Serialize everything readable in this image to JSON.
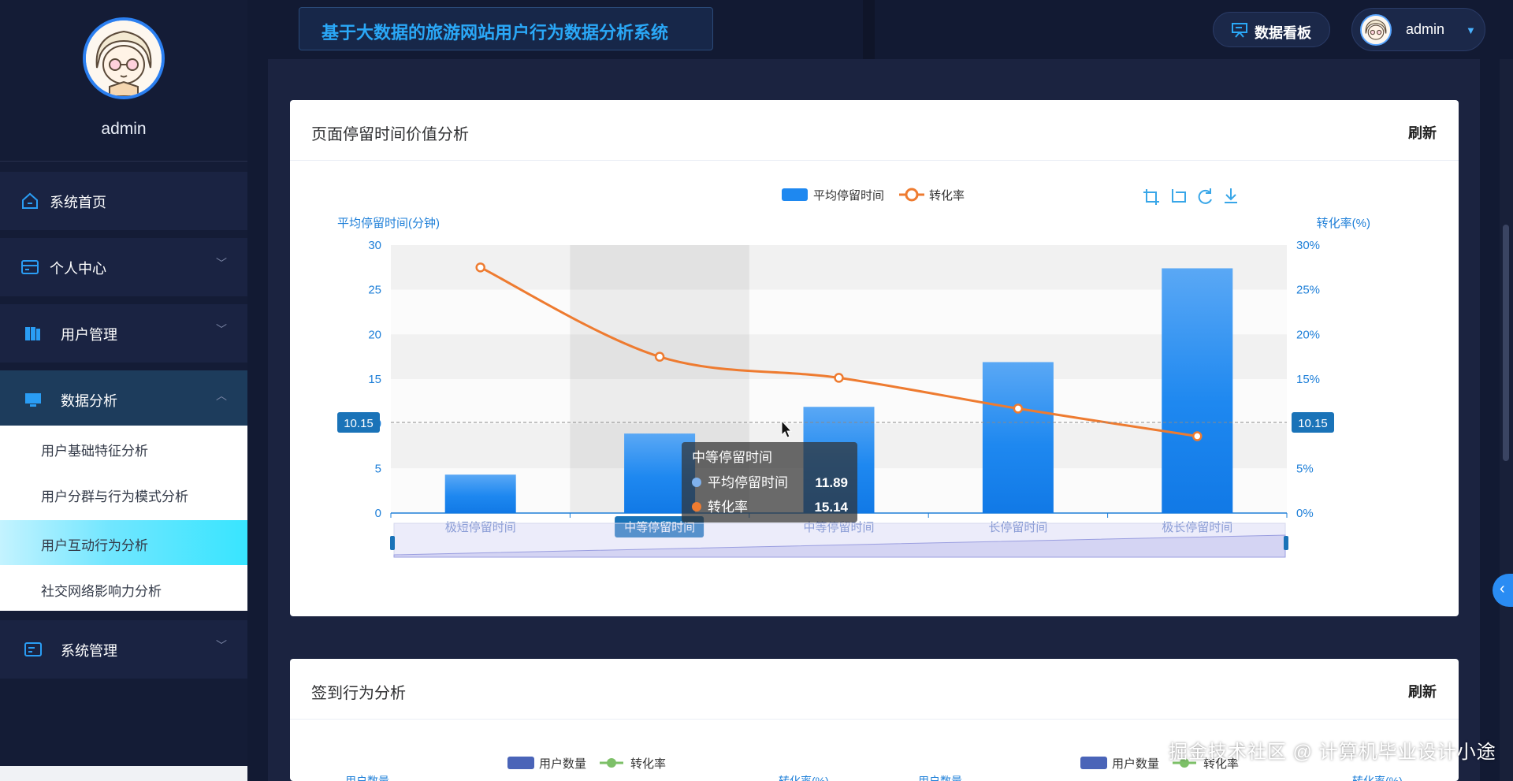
{
  "app": {
    "title": "基于大数据的旅游网站用户行为数据分析系统"
  },
  "header": {
    "dashboard_label": "数据看板",
    "user_name": "admin"
  },
  "sidebar": {
    "user_name": "admin",
    "menu": [
      {
        "label": "系统首页",
        "icon": "home-icon"
      },
      {
        "label": "个人中心",
        "icon": "card-icon"
      },
      {
        "label": "用户管理",
        "icon": "book-icon"
      },
      {
        "label": "数据分析",
        "icon": "monitor-icon"
      },
      {
        "label": "系统管理",
        "icon": "id-card-icon"
      }
    ],
    "submenu": [
      {
        "label": "用户基础特征分析"
      },
      {
        "label": "用户分群与行为模式分析"
      },
      {
        "label": "用户互动行为分析",
        "active": true
      },
      {
        "label": "社交网络影响力分析"
      }
    ]
  },
  "card1": {
    "title": "页面停留时间价值分析",
    "refresh": "刷新"
  },
  "card2": {
    "title": "签到行为分析",
    "refresh": "刷新",
    "legend_left": [
      "用户数量",
      "转化率"
    ],
    "legend_right": [
      "用户数量",
      "转化率"
    ],
    "partial_labels": [
      "用户数量",
      "转化率(%)",
      "用户数量",
      "转化率(%)"
    ]
  },
  "chart_data": {
    "type": "bar",
    "categories": [
      "极短停留时间",
      "中等停留时间",
      "中等停留时间",
      "长停留时间",
      "极长停留时间"
    ],
    "series": [
      {
        "name": "平均停留时间",
        "type": "bar",
        "axis": "left",
        "color": "#1e88f0",
        "values": [
          4.3,
          8.9,
          11.89,
          16.9,
          27.4
        ]
      },
      {
        "name": "转化率",
        "type": "line",
        "axis": "right",
        "color": "#ee7b30",
        "values": [
          27.5,
          17.5,
          15.14,
          11.7,
          8.6
        ]
      }
    ],
    "ylabel": "平均停留时间(分钟)",
    "y2label": "转化率(%)",
    "ylim": [
      0,
      30
    ],
    "y2lim": [
      0,
      30
    ],
    "yticks": [
      "0",
      "5",
      "10",
      "15",
      "20",
      "25",
      "30"
    ],
    "y2ticks": [
      "0%",
      "5%",
      "10%",
      "15%",
      "20%",
      "25%",
      "30%"
    ],
    "hover_line_value": 10.15,
    "hover_line_label": "10.15",
    "highlight_category_label": "中等停留时间",
    "legend_position": "top",
    "grid": true,
    "tooltip": {
      "title": "中等停留时间",
      "rows": [
        {
          "name": "平均停留时间",
          "value": "11.89",
          "color": "#7fb2ee"
        },
        {
          "name": "转化率",
          "value": "15.14",
          "color": "#ee7b30"
        }
      ]
    },
    "toolbox": [
      "zoom-icon",
      "zoom-reset-icon",
      "restore-icon",
      "download-icon"
    ]
  },
  "watermark": "掘金技术社区 @ 计算机毕业设计小途"
}
